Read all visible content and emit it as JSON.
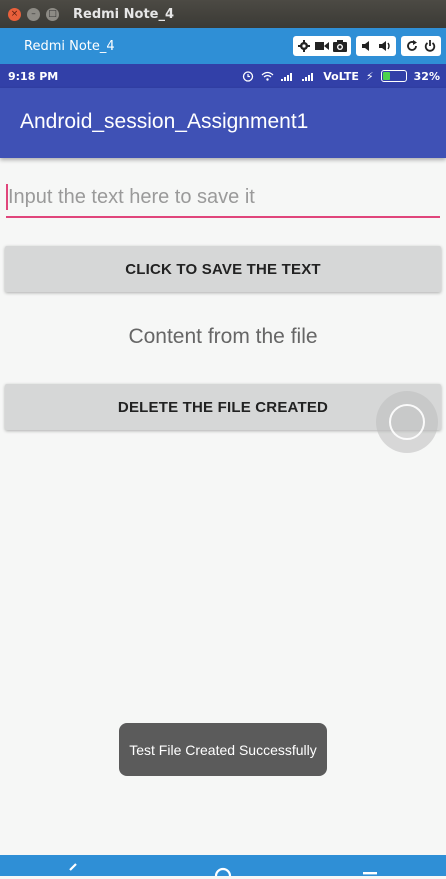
{
  "window": {
    "title": "Redmi Note_4"
  },
  "toolbar": {
    "device_name": "Redmi Note_4",
    "icons": [
      "gear-icon",
      "video-icon",
      "camera-icon",
      "volume-down-icon",
      "volume-up-icon",
      "rotate-icon",
      "power-icon"
    ]
  },
  "statusbar": {
    "time": "9:18 PM",
    "network": "VoLTE",
    "battery": "32%",
    "battery_level": 0.32
  },
  "appbar": {
    "title": "Android_session_Assignment1"
  },
  "input": {
    "placeholder": "Input the text here to save it",
    "value": ""
  },
  "buttons": {
    "save": "CLICK TO SAVE THE TEXT",
    "delete": "DELETE THE FILE CREATED"
  },
  "content": {
    "text": "Content from the file"
  },
  "toast": {
    "text": "Test File Created Successfully"
  },
  "colors": {
    "primary": "#3f51b5",
    "accent": "#e0457b",
    "toolbar": "#2f8fd6"
  }
}
